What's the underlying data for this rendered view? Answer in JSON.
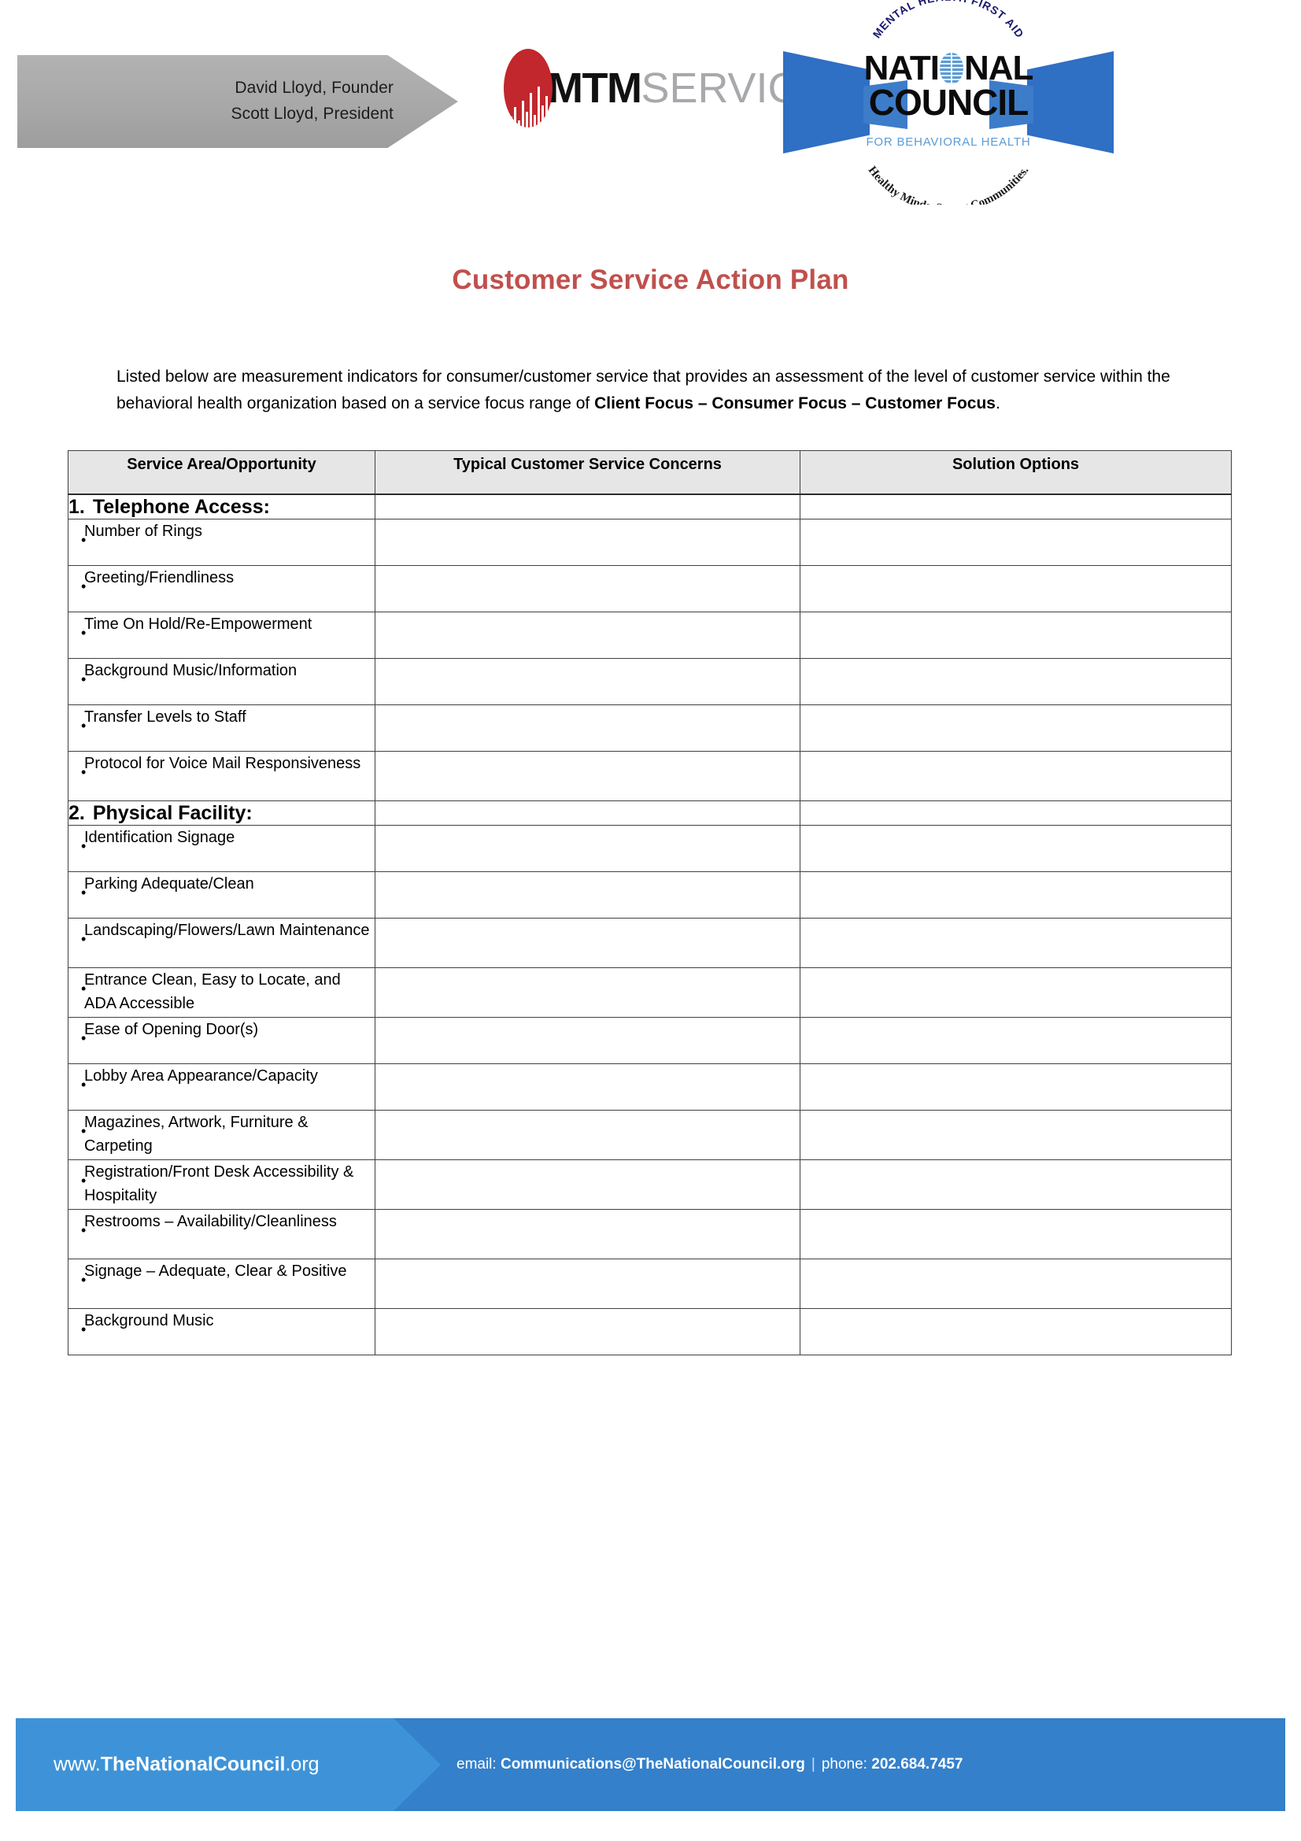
{
  "header": {
    "presenters": [
      "David Lloyd, Founder",
      "Scott Lloyd, President"
    ],
    "mtm_logo": {
      "bold_part": "MTM",
      "light_part": "SERVICES"
    },
    "national_council_logo": {
      "arc_top": "MENTAL HEALTH FIRST AID",
      "line1": "NATI",
      "line1b": "NAL",
      "line2": "COUNCIL",
      "subtitle": "FOR BEHAVIORAL HEALTH",
      "arc_bottom": "Healthy Minds. Strong Communities."
    }
  },
  "title": "Customer Service Action Plan",
  "intro": {
    "part1": "Listed below are measurement indicators for consumer/customer service that provides an assessment of the level of customer service within the behavioral health organization based on a service focus range of ",
    "bold": "Client Focus – Consumer Focus – Customer Focus",
    "part2": "."
  },
  "table": {
    "headers": [
      "Service Area/Opportunity",
      "Typical Customer Service Concerns",
      "Solution Options"
    ],
    "sections": [
      {
        "number": "1.",
        "title": "Telephone Access",
        "colon": ":",
        "items": [
          "Number of Rings",
          "Greeting/Friendliness",
          "Time On Hold/Re-Empowerment",
          "Background Music/Information",
          "Transfer Levels to Staff",
          "Protocol for Voice Mail Responsiveness"
        ]
      },
      {
        "number": "2.",
        "title": "Physical Facility",
        "colon": ":",
        "items": [
          "Identification Signage",
          "Parking Adequate/Clean",
          "Landscaping/Flowers/Lawn Maintenance",
          "Entrance Clean, Easy to Locate, and ADA Accessible",
          "Ease of Opening Door(s)",
          "Lobby Area Appearance/Capacity",
          "Magazines, Artwork, Furniture & Carpeting",
          "Registration/Front Desk Accessibility & Hospitality",
          "Restrooms – Availability/Cleanliness",
          "Signage – Adequate, Clear & Positive",
          "Background Music"
        ]
      }
    ],
    "bullet_glyph": "•"
  },
  "footer": {
    "url_prefix": "www.",
    "url_bold": "TheNationalCouncil",
    "url_suffix": ".org",
    "email_label": "email: ",
    "email": "Communications@TheNationalCouncil.org",
    "separator": "|",
    "phone_label": "phone: ",
    "phone": "202.684.7457"
  },
  "colors": {
    "title_red": "#c0504d",
    "footer_blue_light": "#3e93d8",
    "footer_blue_dark": "#3480cb",
    "mtm_red": "#c1272d",
    "nc_blue": "#2f6fc4",
    "banner_gray": "#a8a8a8",
    "table_header_gray": "#e6e6e6"
  }
}
